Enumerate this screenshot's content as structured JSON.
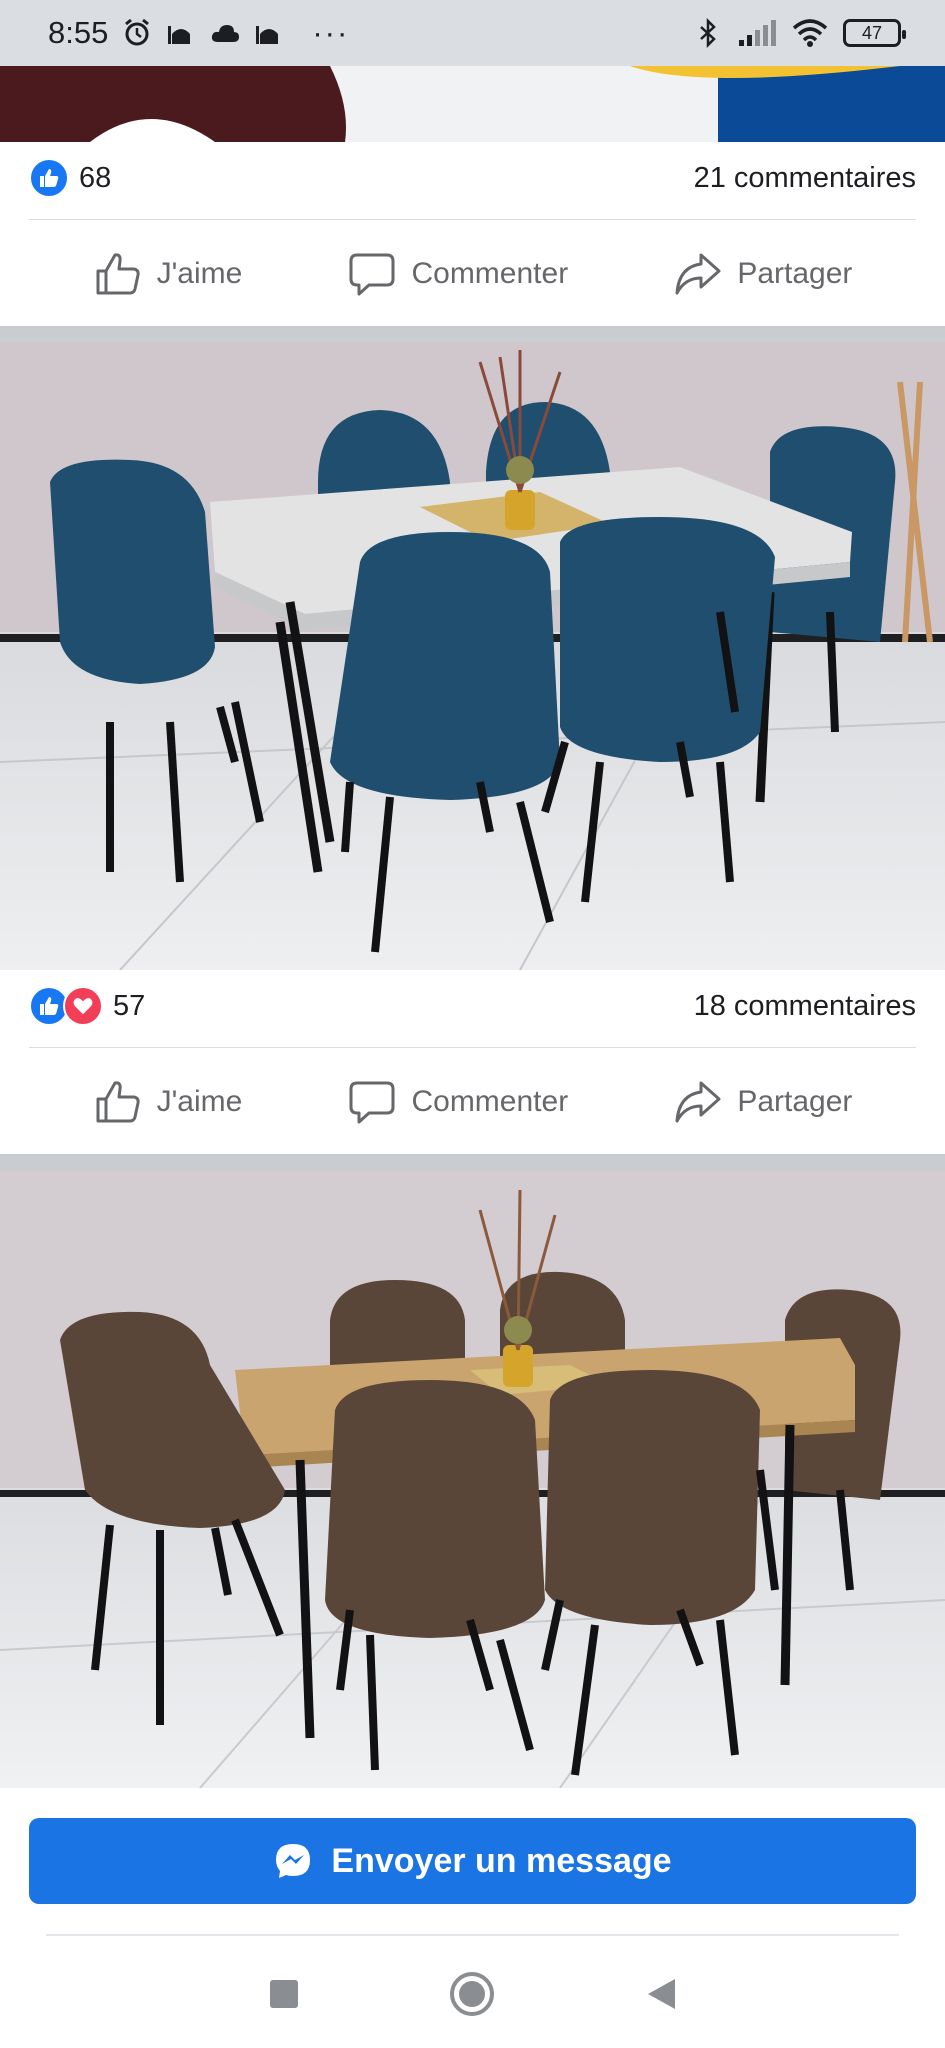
{
  "status_bar": {
    "time": "8:55",
    "more": "···",
    "battery": "47",
    "icons": [
      "alarm-icon",
      "mosque-icon",
      "cloud-icon",
      "mosque-icon",
      "bluetooth-icon",
      "signal-icon",
      "wifi-icon",
      "battery-icon"
    ]
  },
  "posts": [
    {
      "likes": "68",
      "comments": "21 commentaires",
      "reactions": [
        "like"
      ]
    },
    {
      "likes": "57",
      "comments": "18 commentaires",
      "reactions": [
        "like",
        "love"
      ]
    }
  ],
  "actions": {
    "like": "J'aime",
    "comment": "Commenter",
    "share": "Partager"
  },
  "message_button": {
    "label": "Envoyer un message",
    "icon": "messenger-icon"
  },
  "nav": {
    "icons": [
      "recents-square-icon",
      "home-circle-icon",
      "back-triangle-icon"
    ]
  },
  "colors": {
    "facebook_blue": "#1877f2",
    "button_blue": "#1b74e4",
    "love_red": "#f33e58",
    "chair_blue": "#1f4e6e",
    "chair_brown": "#5a4638"
  }
}
